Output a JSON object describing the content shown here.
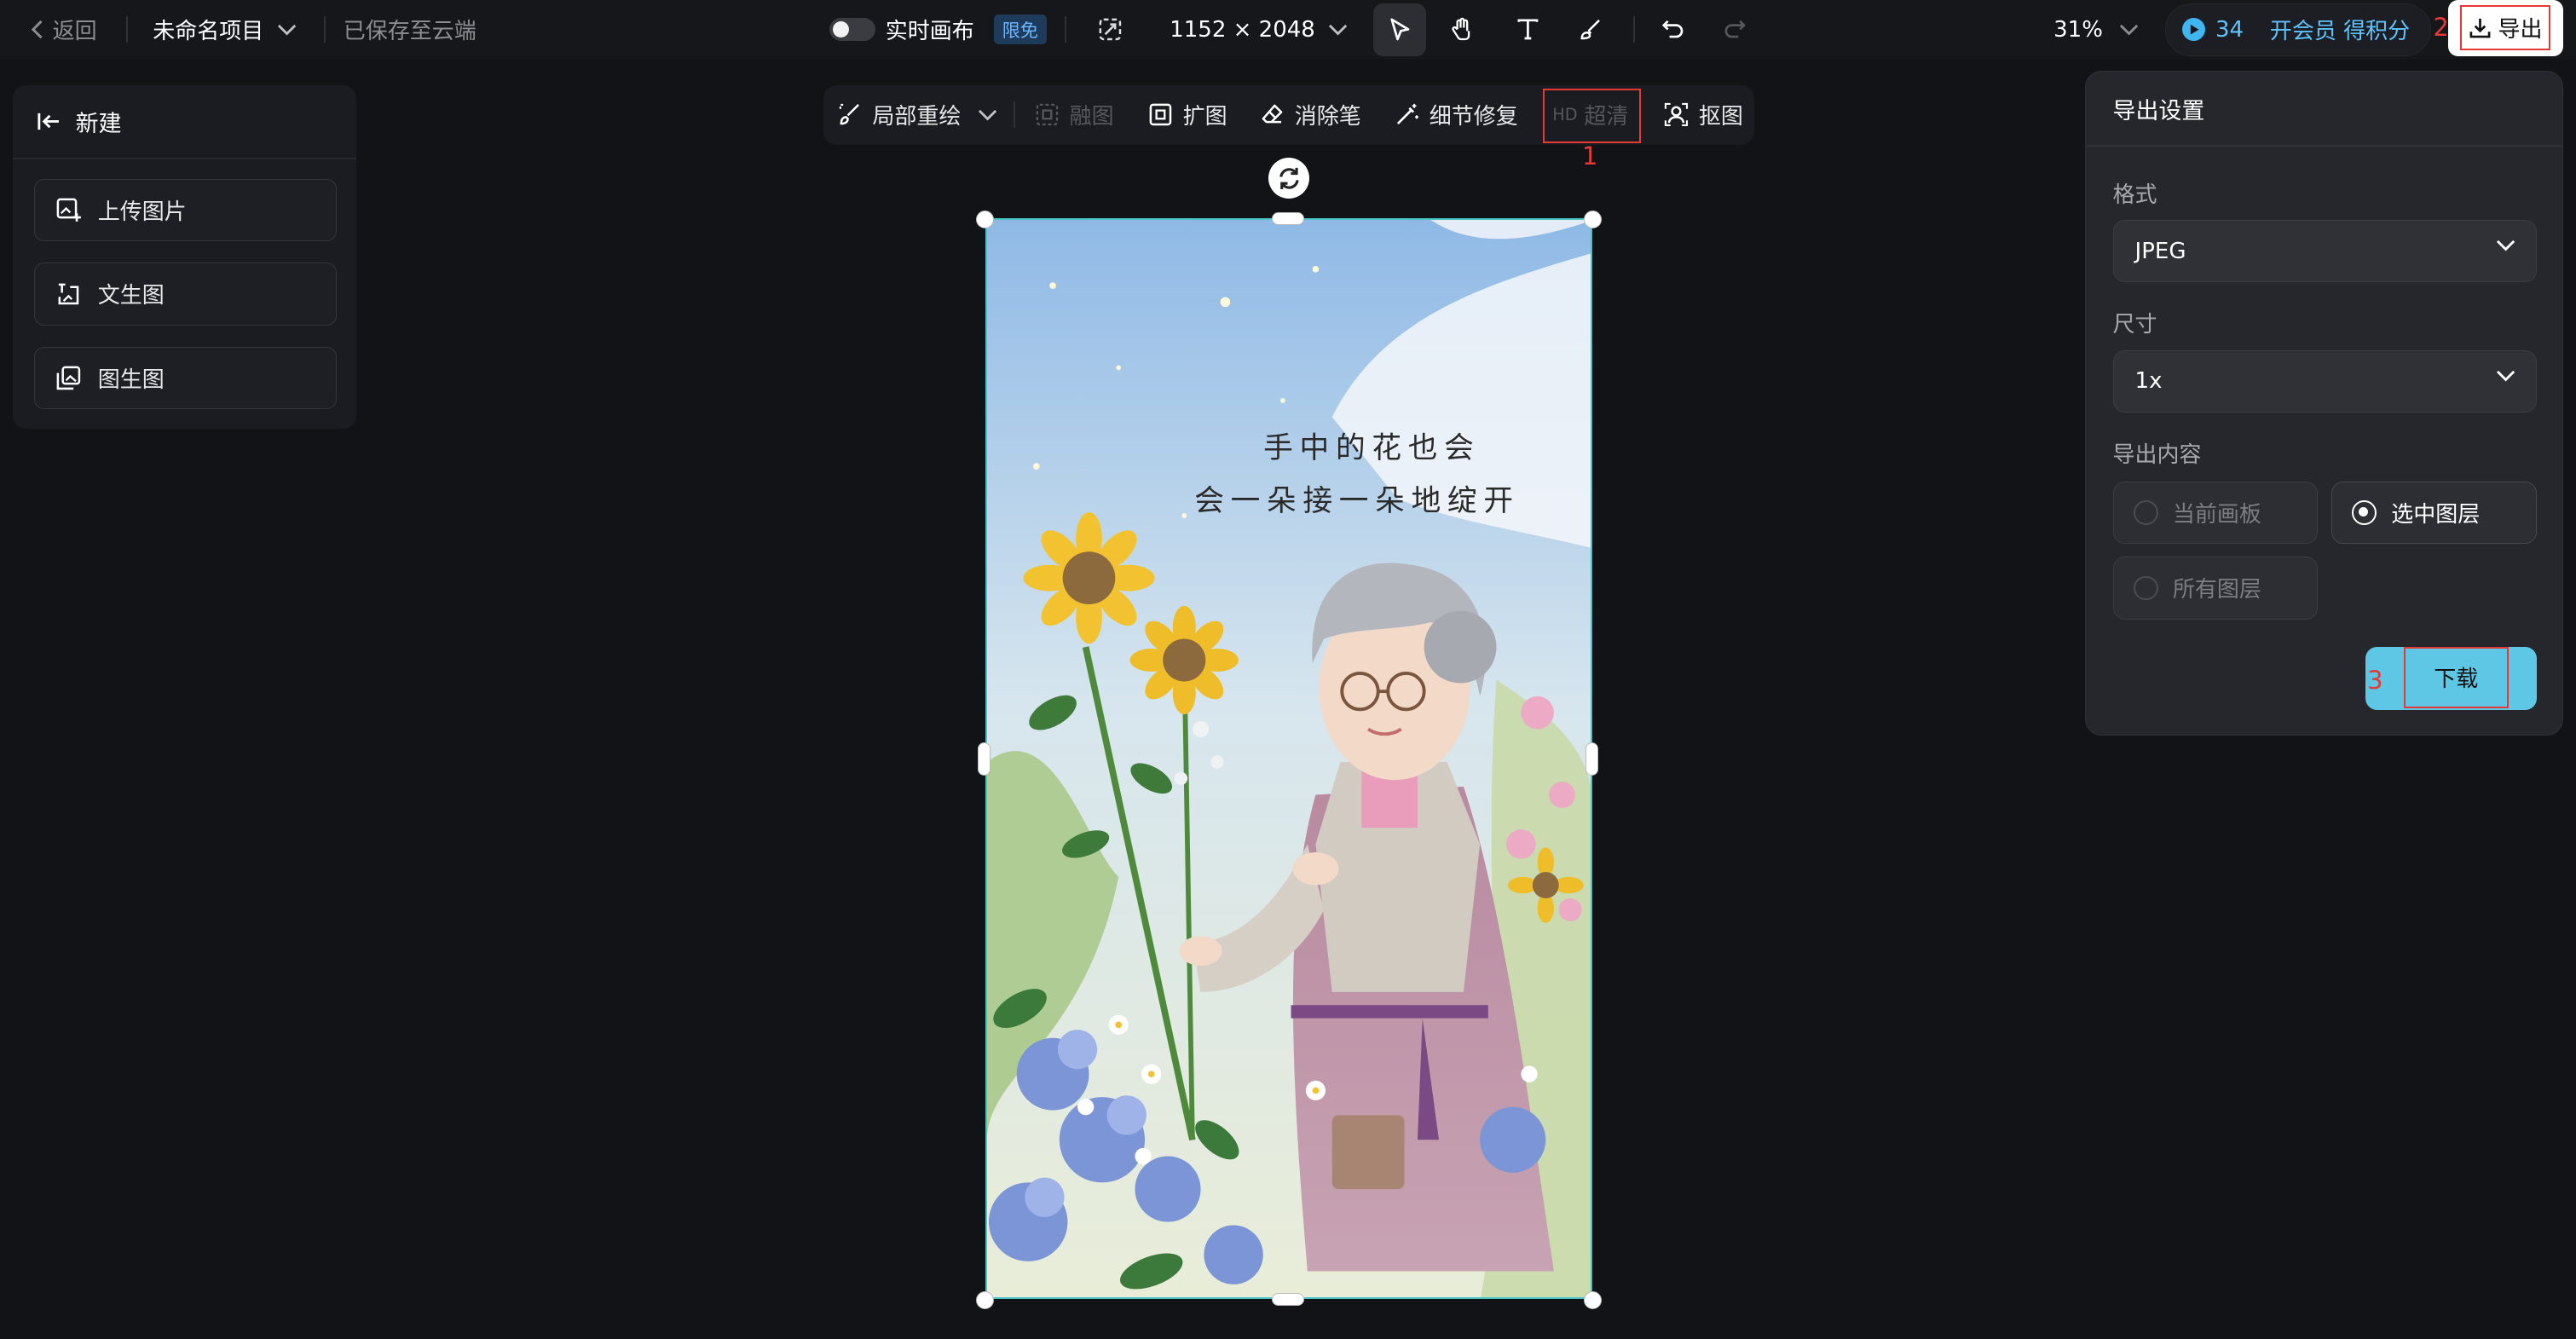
{
  "topbar": {
    "back_label": "返回",
    "project_name": "未命名项目",
    "save_status": "已保存至云端",
    "realtime_canvas_label": "实时画布",
    "limited_free_badge": "限免",
    "canvas_size": "1152 × 2048",
    "zoom_level": "31%",
    "points_count": "34",
    "member_cta": "开会员 得积分",
    "export_label": "导出",
    "marker_2": "2"
  },
  "tools": [
    "select-arrow",
    "hand",
    "text",
    "brush",
    "undo",
    "redo"
  ],
  "left_panel": {
    "new_label": "新建",
    "items": [
      {
        "label": "上传图片",
        "icon": "upload-image-icon"
      },
      {
        "label": "文生图",
        "icon": "text-to-image-icon"
      },
      {
        "label": "图生图",
        "icon": "image-to-image-icon"
      }
    ]
  },
  "edit_toolbar": {
    "items": [
      {
        "label": "局部重绘",
        "enabled": true
      },
      {
        "label": "融图",
        "enabled": false
      },
      {
        "label": "扩图",
        "enabled": true
      },
      {
        "label": "消除笔",
        "enabled": true
      },
      {
        "label": "细节修复",
        "enabled": true
      },
      {
        "label": "超清",
        "prefix": "HD",
        "enabled": false
      },
      {
        "label": "抠图",
        "enabled": true
      }
    ],
    "marker_1": "1"
  },
  "canvas": {
    "poem_line1": "手中的花也会",
    "poem_line2": "会一朵接一朵地绽开"
  },
  "export_panel": {
    "title": "导出设置",
    "format_label": "格式",
    "format_value": "JPEG",
    "size_label": "尺寸",
    "size_value": "1x",
    "content_label": "导出内容",
    "options": [
      {
        "label": "当前画板",
        "selected": false
      },
      {
        "label": "选中图层",
        "selected": true
      },
      {
        "label": "所有图层",
        "selected": false
      }
    ],
    "download_label": "下载",
    "marker_3": "3"
  },
  "colors": {
    "background": "#121317",
    "accent": "#5ec7e6",
    "highlight": "#e53935",
    "member": "#5ec4ff"
  }
}
